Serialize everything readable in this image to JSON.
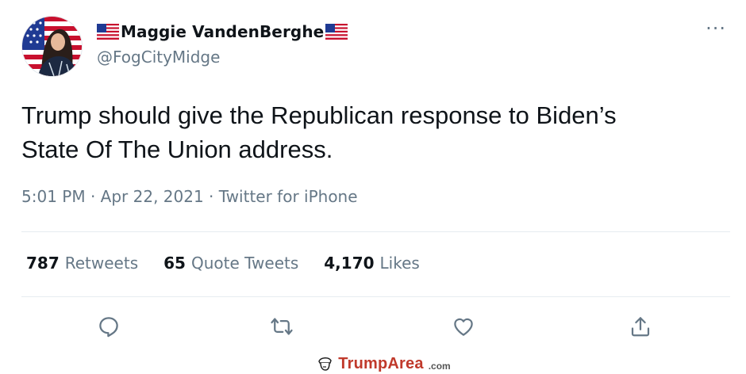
{
  "author": {
    "name": "Maggie VandenBerghe",
    "handle": "@FogCityMidge"
  },
  "tweet": {
    "text_line1": "Trump should give the Republican response to Biden’s",
    "text_line2": "State Of The Union address.",
    "time": "5:01 PM",
    "date": "Apr 22, 2021",
    "client": "Twitter for iPhone"
  },
  "stats": {
    "retweets": {
      "count": "787",
      "label": "Retweets"
    },
    "quotes": {
      "count": "65",
      "label": "Quote Tweets"
    },
    "likes": {
      "count": "4,170",
      "label": "Likes"
    }
  },
  "more_glyph": "···",
  "meta_sep": " · ",
  "watermark": {
    "brand": "TrumpArea",
    "suffix": ".com"
  },
  "colors": {
    "secondary_text": "#657786",
    "primary_text": "#0f1419",
    "icon": "#657786",
    "watermark_red": "#c0392b"
  },
  "icons": [
    "us-flag-icon",
    "more-icon",
    "reply-icon",
    "retweet-icon",
    "like-icon",
    "share-icon",
    "trump-head-icon"
  ]
}
